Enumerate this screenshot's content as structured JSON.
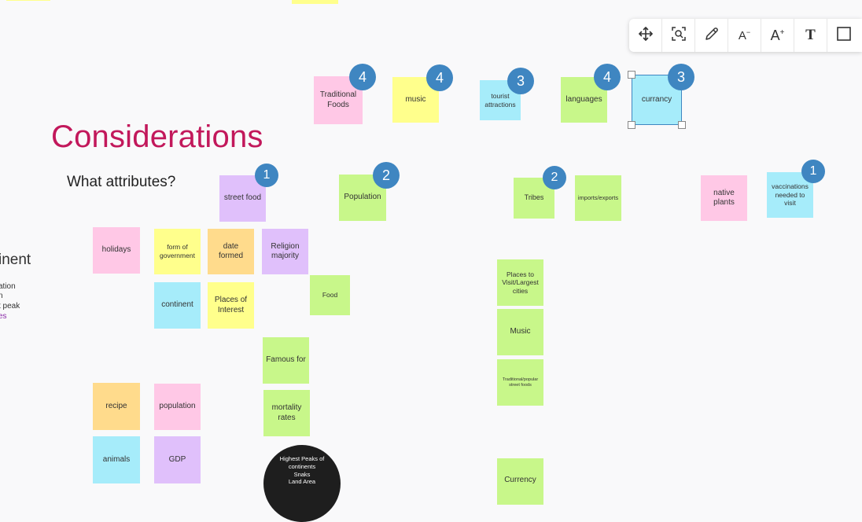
{
  "heading": "Considerations",
  "subheading": "What attributes?",
  "left_edge": {
    "title": "inent",
    "lines": [
      "ation",
      "n",
      "t peak",
      "es"
    ]
  },
  "toolbar": {
    "buttons": [
      {
        "name": "move-icon",
        "glyph": "✥"
      },
      {
        "name": "zoom-to-fit-icon",
        "glyph": "⌕"
      },
      {
        "name": "pen-icon",
        "glyph": "✎"
      },
      {
        "name": "decrease-font-icon",
        "glyph": "A⁻"
      },
      {
        "name": "increase-font-icon",
        "glyph": "A⁺"
      },
      {
        "name": "text-format-icon",
        "glyph": "T"
      },
      {
        "name": "shape-icon",
        "glyph": "□"
      }
    ]
  },
  "notes": {
    "traditional_foods": "Traditional Foods",
    "music_top": "music",
    "tourist_attractions": "tourist attractions",
    "languages": "languages",
    "currancy": "currancy",
    "street_food": "street food",
    "population_top": "Population",
    "tribes": "Tribes",
    "imports_exports": "imports/exports",
    "native_plants": "native plants",
    "vaccinations": "vaccinations needed to visit",
    "holidays": "holidays",
    "form_of_government": "form of government",
    "date_formed": "date formed",
    "religion_majority": "Religion majority",
    "food": "Food",
    "continent": "continent",
    "places_of_interest": "Places of Interest",
    "famous_for": "Famous for",
    "mortality_rates": "mortality rates",
    "recipe": "recipe",
    "population_bottom": "population",
    "animals": "animals",
    "gdp": "GDP",
    "places_to_visit": "Places to Visit/Largest cities",
    "music_right": "Music",
    "traditional_street_foods": "Traditional/popular street foods",
    "currency_bottom": "Currency"
  },
  "votes": {
    "traditional_foods": "4",
    "music": "4",
    "tourist_attractions": "3",
    "languages": "4",
    "currancy": "3",
    "street_food": "1",
    "population": "2",
    "tribes": "2",
    "vaccinations": "1"
  },
  "circle_text": {
    "line1": "Highest Peaks of continents",
    "line2": "Snaks",
    "line3": "Land Area"
  },
  "colors": {
    "pink": "#ffc8e6",
    "yellow": "#ffff8c",
    "cyan": "#a6ecfa",
    "green": "#c8f78a",
    "orange": "#ffdb8c",
    "purple": "#e0c0fb",
    "vote_badge": "#3f86c1",
    "heading": "#c2185b"
  }
}
